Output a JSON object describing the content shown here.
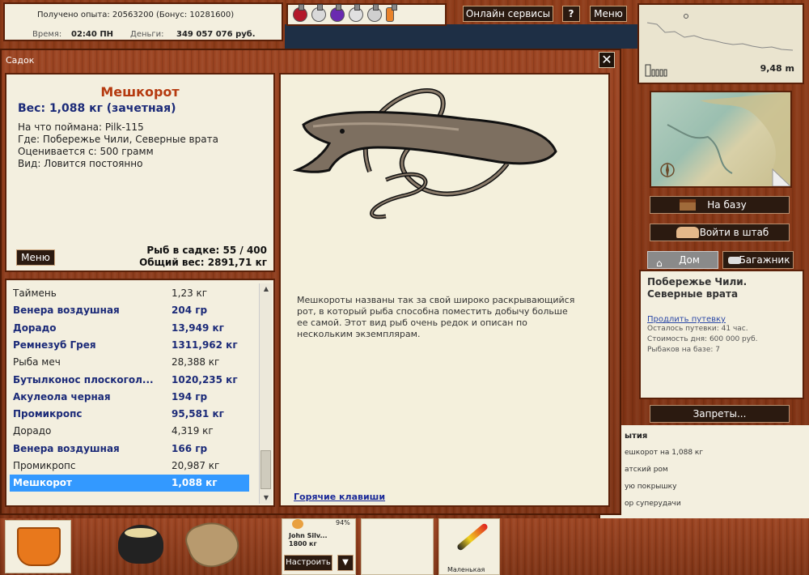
{
  "status": {
    "exp_label": "Получено опыта:",
    "exp_value": "20563200 (Бонус: 10281600)",
    "time_label": "Время:",
    "time_value": "02:40 ПН",
    "money_label": "Деньги:",
    "money_value": "349 057 076 руб."
  },
  "topbar": {
    "online_label": "Онлайн сервисы",
    "help_label": "?",
    "menu_label": "Меню"
  },
  "minimap": {
    "depth": "9,48 m"
  },
  "right": {
    "base_label": "На базу",
    "hq_label": "Войти в штаб",
    "home_tab": "Дом",
    "trunk_tab": "Багажник",
    "location_title": "Побережье Чили. Северные врата",
    "extend_link": "Продлить путевку",
    "remaining": "Осталось путевки: 41 час.",
    "cost": "Стоимость дня: 600 000 руб.",
    "fishers": "Рыбаков на базе: 7",
    "bans_label": "Запреты..."
  },
  "events": {
    "header": "ытия",
    "items": [
      "ешкорот на 1,088 кг",
      "атский ром",
      "ую покрышку",
      "ор суперудачи"
    ]
  },
  "dialog": {
    "title": "Садок",
    "close": "✕",
    "fish_name": "Мешкорот",
    "weight_line": "Вес: 1,088 кг (зачетная)",
    "caught_on": "На что поймана: Pilk-115",
    "where": "Где: Побережье Чили, Северные врата",
    "valued": "Оценивается с: 500 грамм",
    "kind": "Вид: Ловится постоянно",
    "menu_btn": "Меню",
    "count": "Рыб в садке: 55 / 400",
    "total": "Общий вес: 2891,71 кг",
    "description": "Мешкороты названы так за свой широко раскрывающийся рот, в который рыба способна поместить добычу больше ее самой. Этот вид рыб очень редок и описан по нескольким экземплярам.",
    "hotkeys": "Горячие клавиши"
  },
  "fish_list": [
    {
      "name": "Таймень",
      "weight": "1,23 кг",
      "bold": false
    },
    {
      "name": "Венера воздушная",
      "weight": "204 гр",
      "bold": true
    },
    {
      "name": "Дорадо",
      "weight": "13,949 кг",
      "bold": true
    },
    {
      "name": "Ремнезуб Грея",
      "weight": "1311,962 кг",
      "bold": true
    },
    {
      "name": "Рыба меч",
      "weight": "28,388 кг",
      "bold": false
    },
    {
      "name": "Бутылконос плоскогол...",
      "weight": "1020,235 кг",
      "bold": true
    },
    {
      "name": "Акулеола черная",
      "weight": "194 гр",
      "bold": true
    },
    {
      "name": "Промикропс",
      "weight": "95,581 кг",
      "bold": true
    },
    {
      "name": "Дорадо",
      "weight": "4,319 кг",
      "bold": false
    },
    {
      "name": "Венера воздушная",
      "weight": "166 гр",
      "bold": true
    },
    {
      "name": "Промикропс",
      "weight": "20,987 кг",
      "bold": false
    },
    {
      "name": "Мешкорот",
      "weight": "1,088 кг",
      "bold": false,
      "selected": true
    }
  ],
  "tray": {
    "rod_name": "John Silv...",
    "rod_weight": "1800 кг",
    "rod_percent": "94%",
    "configure": "Настроить",
    "float_name": "Маленькая"
  },
  "colors": {
    "accent_selected": "#3399ff",
    "fish_title": "#b53a10",
    "bold_blue": "#1b2a78"
  }
}
